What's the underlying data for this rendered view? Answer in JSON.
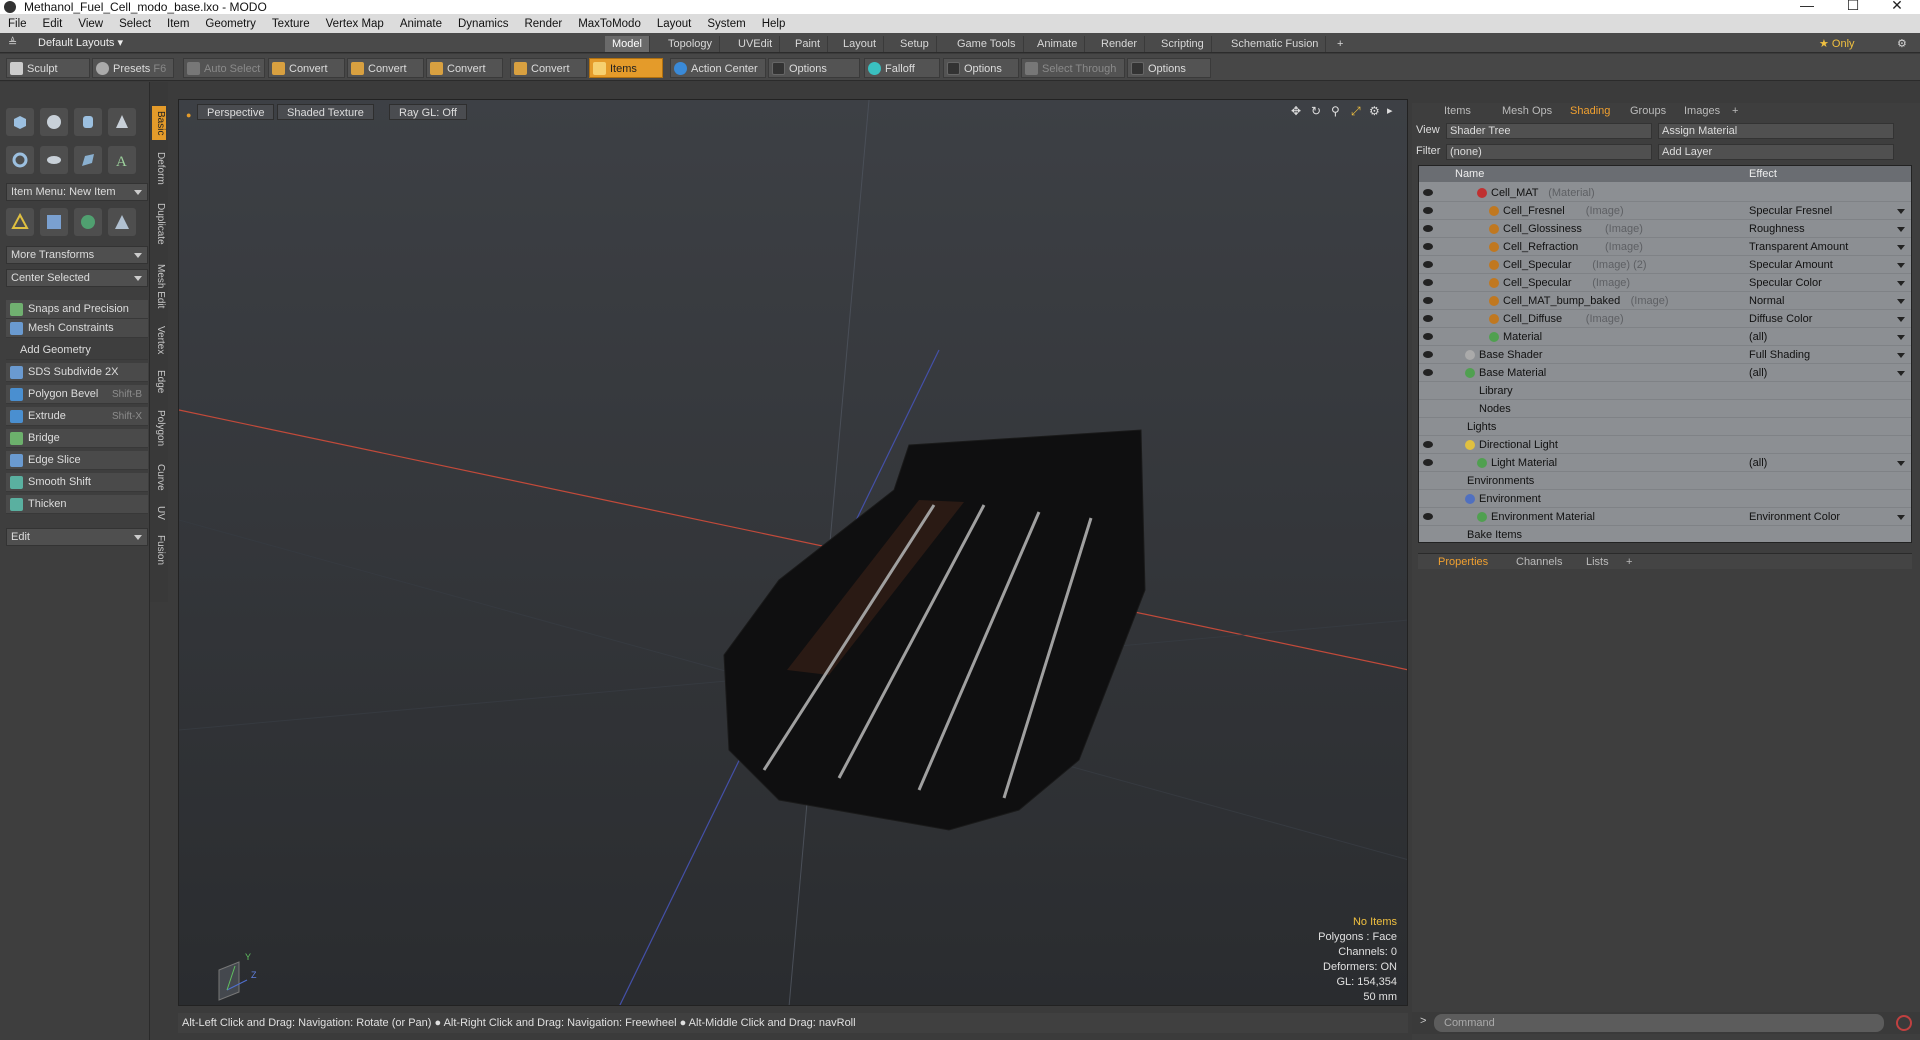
{
  "window": {
    "title": "Methanol_Fuel_Cell_modo_base.lxo - MODO",
    "min": "—",
    "max": "☐",
    "close": "✕"
  },
  "menu": [
    "File",
    "Edit",
    "View",
    "Select",
    "Item",
    "Geometry",
    "Texture",
    "Vertex Map",
    "Animate",
    "Dynamics",
    "Render",
    "MaxToModo",
    "Layout",
    "System",
    "Help"
  ],
  "layout": {
    "preset": "Default Layouts ▾",
    "tabs": [
      "Model",
      "Topology",
      "UVEdit",
      "Paint",
      "Layout",
      "Setup",
      "Game Tools",
      "Animate",
      "Render",
      "Scripting",
      "Schematic Fusion"
    ],
    "add": "+",
    "only": "★  Only",
    "gear": "⚙"
  },
  "toolbar": {
    "sculpt": "Sculpt",
    "presets": "Presets",
    "presets_key": "F6",
    "auto_select": "Auto Select",
    "convert1": "Convert",
    "convert2": "Convert",
    "convert3": "Convert",
    "convert4": "Convert",
    "items": "Items",
    "action_center": "Action Center",
    "options1": "Options",
    "falloff": "Falloff",
    "options2": "Options",
    "select_through": "Select Through",
    "options3": "Options"
  },
  "left": {
    "item_menu": "Item Menu: New Item",
    "more_transforms": "More Transforms",
    "center_selected": "Center Selected",
    "snaps": "Snaps and Precision",
    "mesh_constraints": "Mesh Constraints",
    "add_geometry": "Add Geometry",
    "tools": [
      {
        "label": "SDS Subdivide 2X",
        "key": "",
        "color": "#6a9ad0"
      },
      {
        "label": "Polygon Bevel",
        "key": "Shift-B",
        "color": "#4a8fd0"
      },
      {
        "label": "Extrude",
        "key": "Shift-X",
        "color": "#4a8fd0"
      },
      {
        "label": "Bridge",
        "key": "",
        "color": "#6cb06c"
      },
      {
        "label": "Edge Slice",
        "key": "",
        "color": "#6a9ad0"
      },
      {
        "label": "Smooth Shift",
        "key": "",
        "color": "#5ab0a0"
      },
      {
        "label": "Thicken",
        "key": "",
        "color": "#5ab0a0"
      }
    ],
    "edit": "Edit"
  },
  "vtabs": [
    "Basic",
    "Deform",
    "Duplicate",
    "Mesh Edit",
    "Vertex",
    "Edge",
    "Polygon",
    "Curve",
    "UV",
    "Fusion"
  ],
  "viewport": {
    "view": "Perspective",
    "shading": "Shaded Texture",
    "raygl": "Ray GL: Off",
    "no_items": "No Items",
    "polygons": "Polygons : Face",
    "channels": "Channels: 0",
    "deformers": "Deformers: ON",
    "gl": "GL: 154,354",
    "scale": "50 mm",
    "axis_y": "Y",
    "axis_z": "Z",
    "status": "Alt-Left Click and Drag: Navigation: Rotate (or Pan) ● Alt-Right Click and Drag: Navigation: Freewheel ● Alt-Middle Click and Drag: navRoll"
  },
  "right": {
    "tabs": [
      "Items",
      "Mesh Ops",
      "Shading",
      "Groups",
      "Images",
      "+"
    ],
    "view_label": "View",
    "view_value": "Shader Tree",
    "assign": "Assign Material",
    "filter_label": "Filter",
    "filter_value": "(none)",
    "add_layer": "Add Layer",
    "col_name": "Name",
    "col_effect": "Effect",
    "props_tabs": [
      "Properties",
      "Channels",
      "Lists",
      "+"
    ],
    "command": "Command"
  },
  "tree": [
    {
      "name": "Cell_MAT",
      "type": "(Material)",
      "effect": "",
      "indent": 1,
      "eye": true,
      "color": "#c03030",
      "arrow": false
    },
    {
      "name": "Cell_Fresnel",
      "type": "(Image)",
      "effect": "Specular Fresnel",
      "indent": 2,
      "eye": true,
      "color": "#c07820",
      "arrow": true
    },
    {
      "name": "Cell_Glossiness",
      "type": "(Image)",
      "effect": "Roughness",
      "indent": 2,
      "eye": true,
      "color": "#c07820",
      "arrow": true
    },
    {
      "name": "Cell_Refraction",
      "type": "(Image)",
      "effect": "Transparent Amount",
      "indent": 2,
      "eye": true,
      "color": "#c07820",
      "arrow": true
    },
    {
      "name": "Cell_Specular",
      "type": "(Image) (2)",
      "effect": "Specular Amount",
      "indent": 2,
      "eye": true,
      "color": "#c07820",
      "arrow": true
    },
    {
      "name": "Cell_Specular",
      "type": "(Image)",
      "effect": "Specular Color",
      "indent": 2,
      "eye": true,
      "color": "#c07820",
      "arrow": true
    },
    {
      "name": "Cell_MAT_bump_baked",
      "type": "(Image)",
      "effect": "Normal",
      "indent": 2,
      "eye": true,
      "color": "#c07820",
      "arrow": true
    },
    {
      "name": "Cell_Diffuse",
      "type": "(Image)",
      "effect": "Diffuse Color",
      "indent": 2,
      "eye": true,
      "color": "#c07820",
      "arrow": true
    },
    {
      "name": "Material",
      "type": "",
      "effect": "(all)",
      "indent": 2,
      "eye": true,
      "color": "#50a050",
      "arrow": true
    },
    {
      "name": "Base Shader",
      "type": "",
      "effect": "Full Shading",
      "indent": 0,
      "eye": true,
      "color": "#aaaaaa",
      "arrow": true
    },
    {
      "name": "Base Material",
      "type": "",
      "effect": "(all)",
      "indent": 0,
      "eye": true,
      "color": "#50a050",
      "arrow": true
    },
    {
      "name": "Library",
      "type": "",
      "effect": "",
      "indent": 0,
      "eye": false,
      "color": "",
      "arrow": false
    },
    {
      "name": "Nodes",
      "type": "",
      "effect": "",
      "indent": 0,
      "eye": false,
      "color": "",
      "arrow": false
    },
    {
      "name": "Lights",
      "type": "",
      "effect": "",
      "indent": -1,
      "eye": false,
      "color": "",
      "arrow": false
    },
    {
      "name": "Directional Light",
      "type": "",
      "effect": "",
      "indent": 0,
      "eye": true,
      "color": "#e0c040",
      "arrow": false
    },
    {
      "name": "Light Material",
      "type": "",
      "effect": "(all)",
      "indent": 1,
      "eye": true,
      "color": "#50a050",
      "arrow": true
    },
    {
      "name": "Environments",
      "type": "",
      "effect": "",
      "indent": -1,
      "eye": false,
      "color": "",
      "arrow": false
    },
    {
      "name": "Environment",
      "type": "",
      "effect": "",
      "indent": 0,
      "eye": false,
      "color": "#5070c0",
      "arrow": false
    },
    {
      "name": "Environment Material",
      "type": "",
      "effect": "Environment Color",
      "indent": 1,
      "eye": true,
      "color": "#50a050",
      "arrow": true
    },
    {
      "name": "Bake Items",
      "type": "",
      "effect": "",
      "indent": -1,
      "eye": false,
      "color": "",
      "arrow": false
    }
  ]
}
